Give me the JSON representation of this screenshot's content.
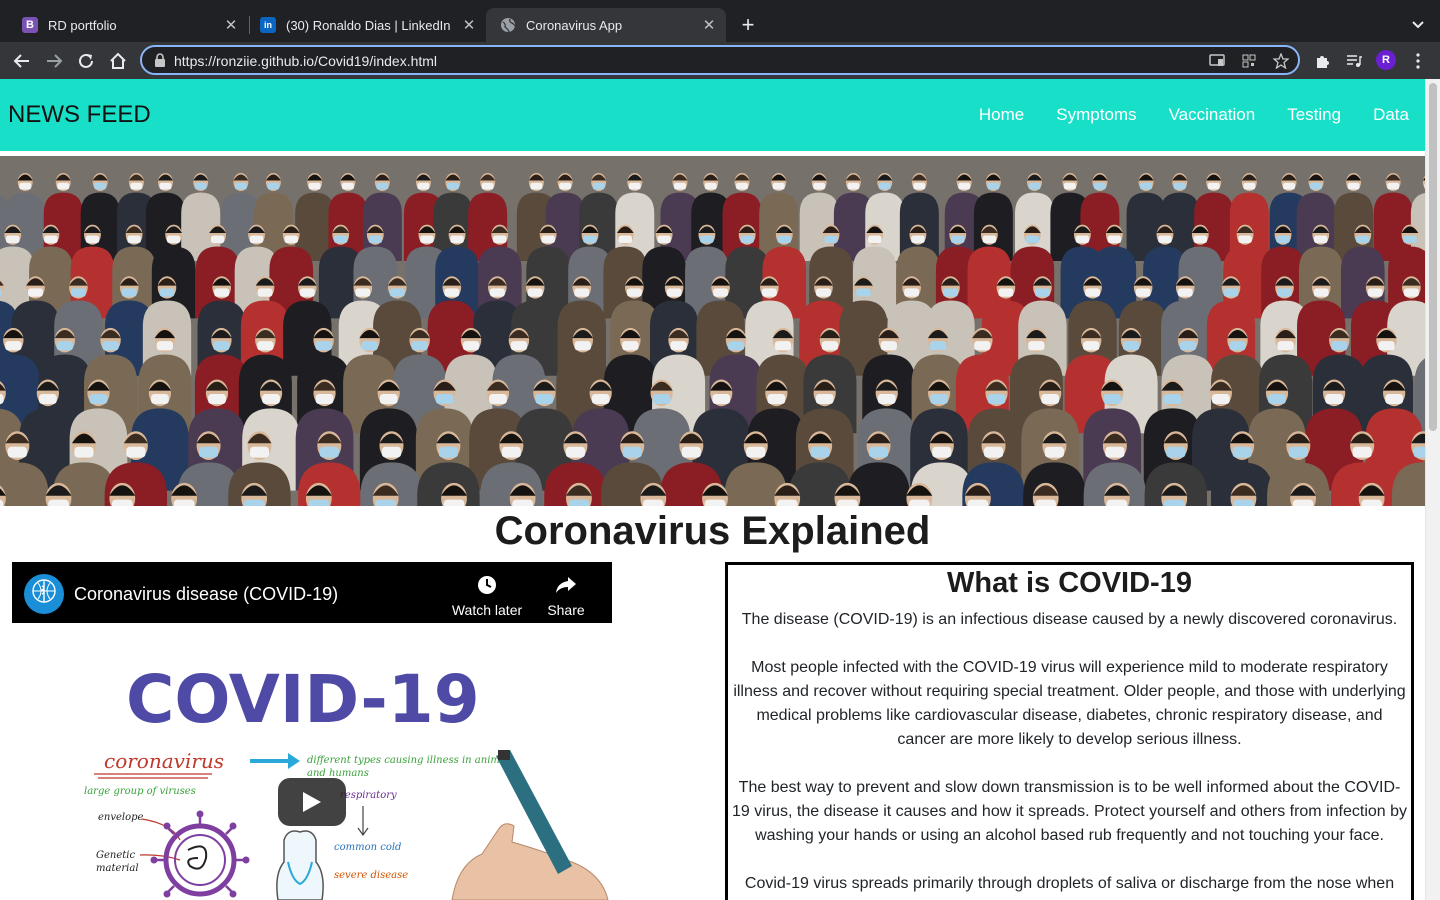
{
  "browser": {
    "tabs": [
      {
        "title": "RD portfolio",
        "favicon": "B"
      },
      {
        "title": "(30) Ronaldo Dias | LinkedIn",
        "favicon": "in"
      },
      {
        "title": "Coronavirus App",
        "favicon": "globe"
      }
    ],
    "active_tab": 2,
    "url": "https://ronziie.github.io/Covid19/index.html",
    "profile_initial": "R"
  },
  "navbar": {
    "brand": "NEWS FEED",
    "links": [
      "Home",
      "Symptoms",
      "Vaccination",
      "Testing",
      "Data"
    ],
    "background": "#18e0c8"
  },
  "main": {
    "heading": "Coronavirus Explained"
  },
  "video": {
    "title": "Coronavirus disease (COVID-19)",
    "watch_later": "Watch later",
    "share": "Share",
    "thumbnail": {
      "headline": "COVID-19",
      "labels": {
        "coronavirus": "coronavirus",
        "types": "different types causing illness in animals",
        "humans": "and humans",
        "group": "large group of viruses",
        "envelope": "envelope",
        "respiratory": "respiratory",
        "genetic1": "Genetic",
        "genetic2": "material",
        "cold": "common cold",
        "severe": "severe disease"
      }
    }
  },
  "info": {
    "title": "What is COVID-19",
    "paragraphs": [
      "The disease (COVID-19) is an infectious disease caused by a newly discovered coronavirus.",
      "Most people infected with the COVID-19 virus will experience mild to moderate respiratory illness and recover without requiring special treatment. Older people, and those with underlying medical problems like cardiovascular disease, diabetes, chronic respiratory disease, and cancer are more likely to develop serious illness.",
      "The best way to prevent and slow down transmission is to be well informed about the COVID-19 virus, the disease it causes and how it spreads. Protect yourself and others from infection by washing your hands or using an alcohol based rub frequently and not touching your face.",
      "Covid-19 virus spreads primarily through droplets of saliva or discharge from the nose when"
    ]
  }
}
